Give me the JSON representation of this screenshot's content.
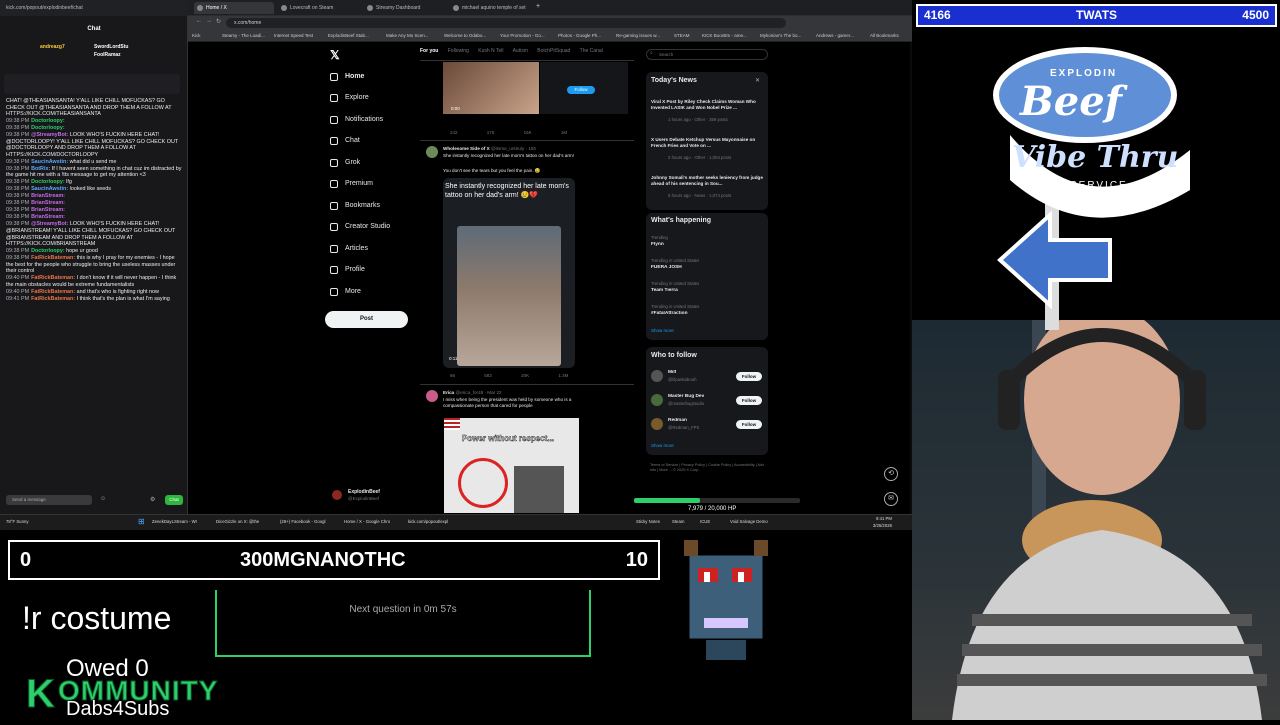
{
  "browser": {
    "chat_url": "kick.com/popout/explodinbeef/chat",
    "tabs": [
      {
        "label": "Home / X",
        "active": true
      },
      {
        "label": "Lovecraft on Steam",
        "active": false
      },
      {
        "label": "Streamy Dashboard",
        "active": false
      },
      {
        "label": "michael aquino temple of set",
        "active": false
      }
    ],
    "address": "x.com/home",
    "bookmarks": [
      "Kick",
      "Steamy - The Loadi...",
      "Internet Speed Test",
      "ExplodinBeef Stab...",
      "Make Any Mo Scen...",
      "Welcome to Odabo...",
      "Your Promotion - Go...",
      "Photos - Google Ph...",
      "Re-gaming issues w...",
      "STEAM",
      "KICK Boosttm - ame...",
      "Mykonian's The bo...",
      "Andrews - gamer...",
      "All Bookmarks"
    ]
  },
  "chat": {
    "header": "Chat",
    "pinned_users": [
      "andreazg7",
      "SwordLordStu",
      "FoolRamaz"
    ],
    "input_placeholder": "Send a message",
    "send_label": "Chat",
    "messages": [
      {
        "text": "CHAT! @THEASIANSANTA! Y'ALL LIKE CHILL MOFUCKAS? GO CHECK OUT @THEASIANSANTA AND DROP THEM A FOLLOW AT HTTPS://KICK.COM/THEASIANSANTA",
        "ts": "",
        "user": "",
        "color": "#efeff1"
      },
      {
        "ts": "09:38 PM",
        "user": "Doctorloopy:",
        "text": "",
        "color": "#2dcf6a"
      },
      {
        "ts": "09:38 PM",
        "user": "Doctorloopy:",
        "text": "",
        "color": "#2dcf6a"
      },
      {
        "ts": "09:38 PM",
        "user": "@StreamyBot:",
        "text": "LOOK WHO'S FUCKIN HERE CHAT! @DOCTORLOOPY! Y'ALL LIKE CHILL MOFUCKAS? GO CHECK OUT @DOCTORLOOPY AND DROP THEM A FOLLOW AT HTTPS://KICK.COM/DOCTORLOOPY",
        "color": "#c56ae8"
      },
      {
        "ts": "09:38 PM",
        "user": "SaucinAwstin:",
        "text": "what did u send me",
        "color": "#5aa9ff"
      },
      {
        "ts": "09:38 PM",
        "user": "BotRix:",
        "text": "If I havent seen something in chat cuz im distracted by the game hit me with a !tts message to get my attention <3",
        "color": "#5aa9ff"
      },
      {
        "ts": "09:38 PM",
        "user": "Doctorloopy:",
        "text": "lfg",
        "color": "#2dcf6a"
      },
      {
        "ts": "09:38 PM",
        "user": "SaucinAwstin:",
        "text": "looked like seeds",
        "color": "#5aa9ff"
      },
      {
        "ts": "09:38 PM",
        "user": "BrianStream:",
        "text": "",
        "color": "#c56ae8"
      },
      {
        "ts": "09:38 PM",
        "user": "BrianStream:",
        "text": "",
        "color": "#c56ae8"
      },
      {
        "ts": "09:38 PM",
        "user": "BrianStream:",
        "text": "",
        "color": "#c56ae8"
      },
      {
        "ts": "09:38 PM",
        "user": "BrianStream:",
        "text": "",
        "color": "#c56ae8"
      },
      {
        "ts": "09:38 PM",
        "user": "@StreamyBot:",
        "text": "LOOK WHO'S FUCKIN HERE CHAT! @BRIANSTREAM! Y'ALL LIKE CHILL MOFUCKAS? GO CHECK OUT @BRIANSTREAM AND DROP THEM A FOLLOW AT HTTPS://KICK.COM/BRIANSTREAM",
        "color": "#c56ae8"
      },
      {
        "ts": "09:38 PM",
        "user": "Doctorloopy:",
        "text": "hope ur good",
        "color": "#2dcf6a"
      },
      {
        "ts": "09:38 PM",
        "user": "FatRickBateman:",
        "text": "this is why I pray for my enemies - I hope the best for the people who struggle to bring the useless masses under their control",
        "color": "#e8734a"
      },
      {
        "ts": "09:40 PM",
        "user": "FatRickBateman:",
        "text": "I don't know if it will never happen - I think the main obstacles would be extreme fundamentalists",
        "color": "#e8734a"
      },
      {
        "ts": "09:40 PM",
        "user": "FatRickBateman:",
        "text": "and that's who is fighting right now",
        "color": "#e8734a"
      },
      {
        "ts": "09:41 PM",
        "user": "FatRickBateman:",
        "text": "I think that's the plan is what I'm saying",
        "color": "#e8734a"
      }
    ]
  },
  "x": {
    "nav": [
      {
        "label": "Home",
        "icon": "home-icon"
      },
      {
        "label": "Explore",
        "icon": "search-icon"
      },
      {
        "label": "Notifications",
        "icon": "bell-icon"
      },
      {
        "label": "Chat",
        "icon": "mail-icon"
      },
      {
        "label": "Grok",
        "icon": "grok-icon"
      },
      {
        "label": "Premium",
        "icon": "x-logo-icon"
      },
      {
        "label": "Bookmarks",
        "icon": "bookmark-icon"
      },
      {
        "label": "Creator Studio",
        "icon": "creator-icon"
      },
      {
        "label": "Articles",
        "icon": "articles-icon"
      },
      {
        "label": "Profile",
        "icon": "person-icon"
      },
      {
        "label": "More",
        "icon": "more-icon"
      }
    ],
    "post_label": "Post",
    "account_name": "ExplodinBeef",
    "account_handle": "@ExplodinBeef",
    "feed_tabs": [
      "For you",
      "Following",
      "Kush N Tell",
      "Autism",
      "BotchPitSquad",
      "The Canal"
    ],
    "tweets": [
      {
        "author": "Wholesome Side of X",
        "handle": "@itsme_urstruly · 16h",
        "text": "She instantly recognized her late mom's tattoo on her dad's arm!",
        "body2": "You don't see the tears but you feel the pain. 😢",
        "overlay": "She instantly recognized her late mom's tattoo on her dad's arm! 😢💔",
        "duration": "0:11",
        "stats": [
          "66",
          "583",
          "20K",
          "1.3M"
        ]
      },
      {
        "author": "Erica",
        "handle": "@erica_for48 · Mar 22",
        "text": "I miss when being the president was held by someone who is a compassionate person that cared for people",
        "overlay": "Power without respect..."
      }
    ],
    "top_tweet_stats": [
      "242",
      "175",
      "16K",
      "1M"
    ],
    "top_tweet_duration": "0:00",
    "follow_label": "Follow",
    "search_placeholder": "Search",
    "news": {
      "title": "Today's News",
      "items": [
        {
          "headline": "Viral X Post by Riley Check Claims Woman Who Invented LASIK and Won Nobel Prize ...",
          "meta": "1 hours ago · Other · 359 posts"
        },
        {
          "headline": "X Users Debate Ketchup Versus Mayonnaise on French Fries and Vote on ...",
          "meta": "2 hours ago · Other · 1,004 posts"
        },
        {
          "headline": "Johnny Somali's mother seeks leniency from judge ahead of his sentencing in Sou...",
          "meta": "5 hours ago · News · 1,074 posts"
        }
      ]
    },
    "happening": {
      "title": "What's happening",
      "items": [
        {
          "context": "Trending",
          "name": "Flynn"
        },
        {
          "context": "Trending in United States",
          "name": "FUERA JOSH"
        },
        {
          "context": "Trending in United States",
          "name": "Team Tierra"
        },
        {
          "context": "Trending in United States",
          "name": "#FatalAttraction"
        }
      ],
      "show_more": "Show more"
    },
    "who_to_follow": {
      "title": "Who to follow",
      "accounts": [
        {
          "name": "Milf",
          "handle": "@lilpankabouh"
        },
        {
          "name": "Master Bug Dev",
          "handle": "@masterbugstudio"
        },
        {
          "name": "Redman",
          "handle": "@Redman_FPS"
        }
      ],
      "show_more": "Show more"
    },
    "footer": "Terms of Service | Privacy Policy | Cookie Policy | Accessibility | Ads info | More ... © 2025 X Corp."
  },
  "taskbar": {
    "weather": "78°F Sunny",
    "items": [
      "ZenekDayLStream - Wr",
      "DiceGizzle on X: @the",
      "(28+) Facebook - Googl",
      "Home / X - Google Chro",
      "kick.com/popout/expl",
      "",
      "",
      "Sticky Notes",
      "Steam",
      "ICUE",
      "Void Salvage Demo"
    ],
    "time": "9:41 PM",
    "date": "3/25/2026"
  },
  "overlays": {
    "top_left_score": "4166",
    "top_label": "TWATS",
    "top_right_score": "4500",
    "bottom_left_score": "0",
    "bottom_label": "300MGNANOTHC",
    "bottom_right_score": "10",
    "command": "!r costume",
    "owed": "Owed 0",
    "kommunity": "OMMUNITY",
    "kommunity_k": "K",
    "dabs": "Dabs4Subs",
    "next_question": "Next question in 0m 57s",
    "hp": "7,979 / 20,000 HP",
    "hp_fraction": 0.399,
    "logo_top": "EXPLODIN",
    "logo_main": "Beef",
    "logo_sub": "Vibe Thru",
    "logo_service": "SERVICE",
    "accent_green": "#2dcf6a",
    "score_blue": "#1a2fd0"
  }
}
